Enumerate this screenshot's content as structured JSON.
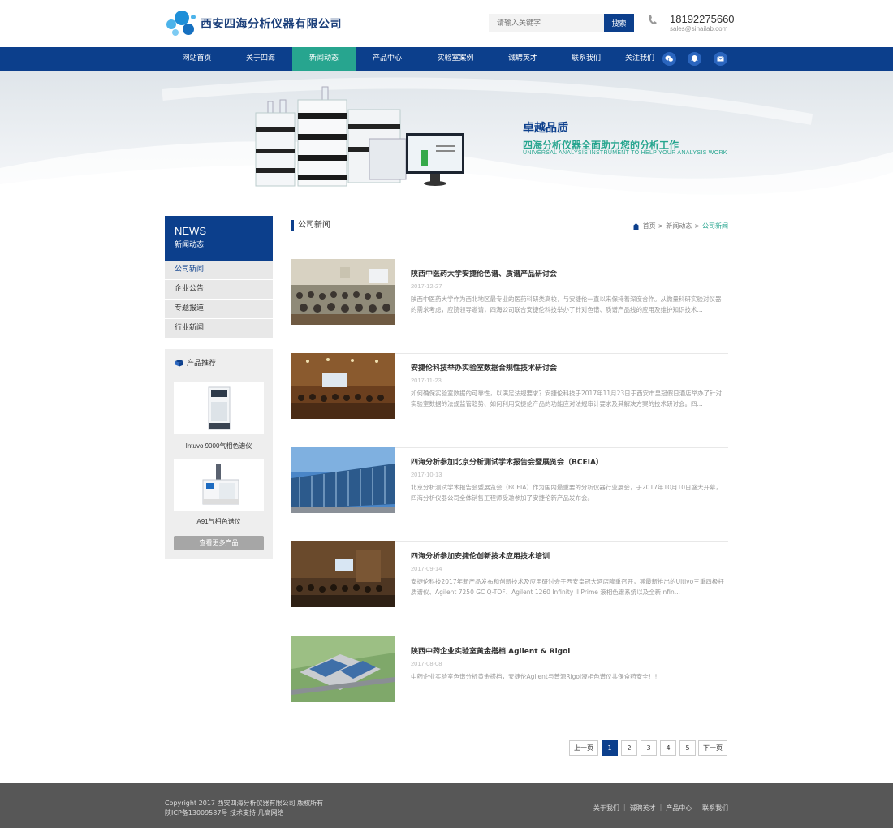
{
  "header": {
    "company_name": "西安四海分析仪器有限公司",
    "search_placeholder": "请输入关键字",
    "search_label": "搜索",
    "phone": "18192275660",
    "email": "sales@sihailab.com"
  },
  "nav": {
    "items": [
      "网站首页",
      "关于四海",
      "新闻动态",
      "产品中心",
      "实验室案例",
      "诚聘英才",
      "联系我们",
      "关注我们"
    ],
    "active_index": 2
  },
  "banner": {
    "headline": "卓越品质",
    "subheadline": "四海分析仪器全面助力您的分析工作",
    "english": "UNIVERSAL ANALYSIS INSTRUMENT TO HELP YOUR ANALYSIS WORK"
  },
  "sidebar": {
    "title_en": "NEWS",
    "title_cn": "新闻动态",
    "items": [
      "公司新闻",
      "企业公告",
      "专题报道",
      "行业新闻"
    ],
    "products_title": "产品推荐",
    "products": [
      "Intuvo 9000气相色谱仪",
      "A91气相色谱仪"
    ],
    "more_label": "查看更多产品"
  },
  "main": {
    "title": "公司新闻",
    "breadcrumb": [
      "首页",
      "新闻动态",
      "公司新闻"
    ],
    "breadcrumb_sep": ">",
    "news": [
      {
        "title": "陕西中医药大学安捷伦色谱、质谱产品研讨会",
        "date": "2017-12-27",
        "desc": "陕西中医药大学作为西北地区最专业的医药科研类高校，与安捷伦一直以来保持着深度合作。从微量科研实验对仪器的需求考虑，应院领导邀请，四海公司联合安捷伦科技举办了针对色谱、质谱产品线的应用及维护知识技术..."
      },
      {
        "title": "安捷伦科技举办实验室数据合规性技术研讨会",
        "date": "2017-11-23",
        "desc": "如何确保实验室数据的可靠性，以满足法规要求？安捷伦科技于2017年11月23日于西安市皇冠假日酒店举办了针对实验室数据的法规监管趋势、如何利用安捷伦产品的功能应对法规审计要求及其解决方案的技术研讨会。四..."
      },
      {
        "title": "四海分析参加北京分析测试学术报告会暨展览会（BCEIA）",
        "date": "2017-10-13",
        "desc": "北京分析测试学术报告会暨展览会（BCEIA）作为国内最重要的分析仪器行业展会，于2017年10月10日盛大开幕，四海分析仪器公司全体销售工程师受邀参加了安捷伦新产品发布会。"
      },
      {
        "title": "四海分析参加安捷伦创新技术应用技术培训",
        "date": "2017-09-14",
        "desc": "安捷伦科技2017年新产品发布和创新技术及应用研讨会于西安皇冠大酒店隆重召开，其最新推出的Ultivo三重四极杆质谱仪、Agilent 7250 GC Q-TOF、Agilent 1260 Infinity II Prime 液相色谱系统以及全新Infin..."
      },
      {
        "title": "陕西中药企业实验室黄金搭档 Agilent & Rigol",
        "date": "2017-08-08",
        "desc": "中药企业实验室色谱分析黄金搭档，安捷伦Agilent与普源Rigol液相色谱仪共保食药安全！！！"
      }
    ]
  },
  "pager": {
    "prev": "上一页",
    "pages": [
      "1",
      "2",
      "3",
      "4",
      "5"
    ],
    "next": "下一页",
    "active": "1"
  },
  "footer": {
    "copyright": "Copyright 2017 西安四海分析仪器有限公司 版权所有",
    "icp": "陕ICP备13009587号 技术支持 凡高网络",
    "links": [
      "关于我们",
      "诚聘英才",
      "产品中心",
      "联系我们"
    ]
  },
  "colors": {
    "brand_blue": "#0c3f8c",
    "accent_green": "#27a58f"
  }
}
